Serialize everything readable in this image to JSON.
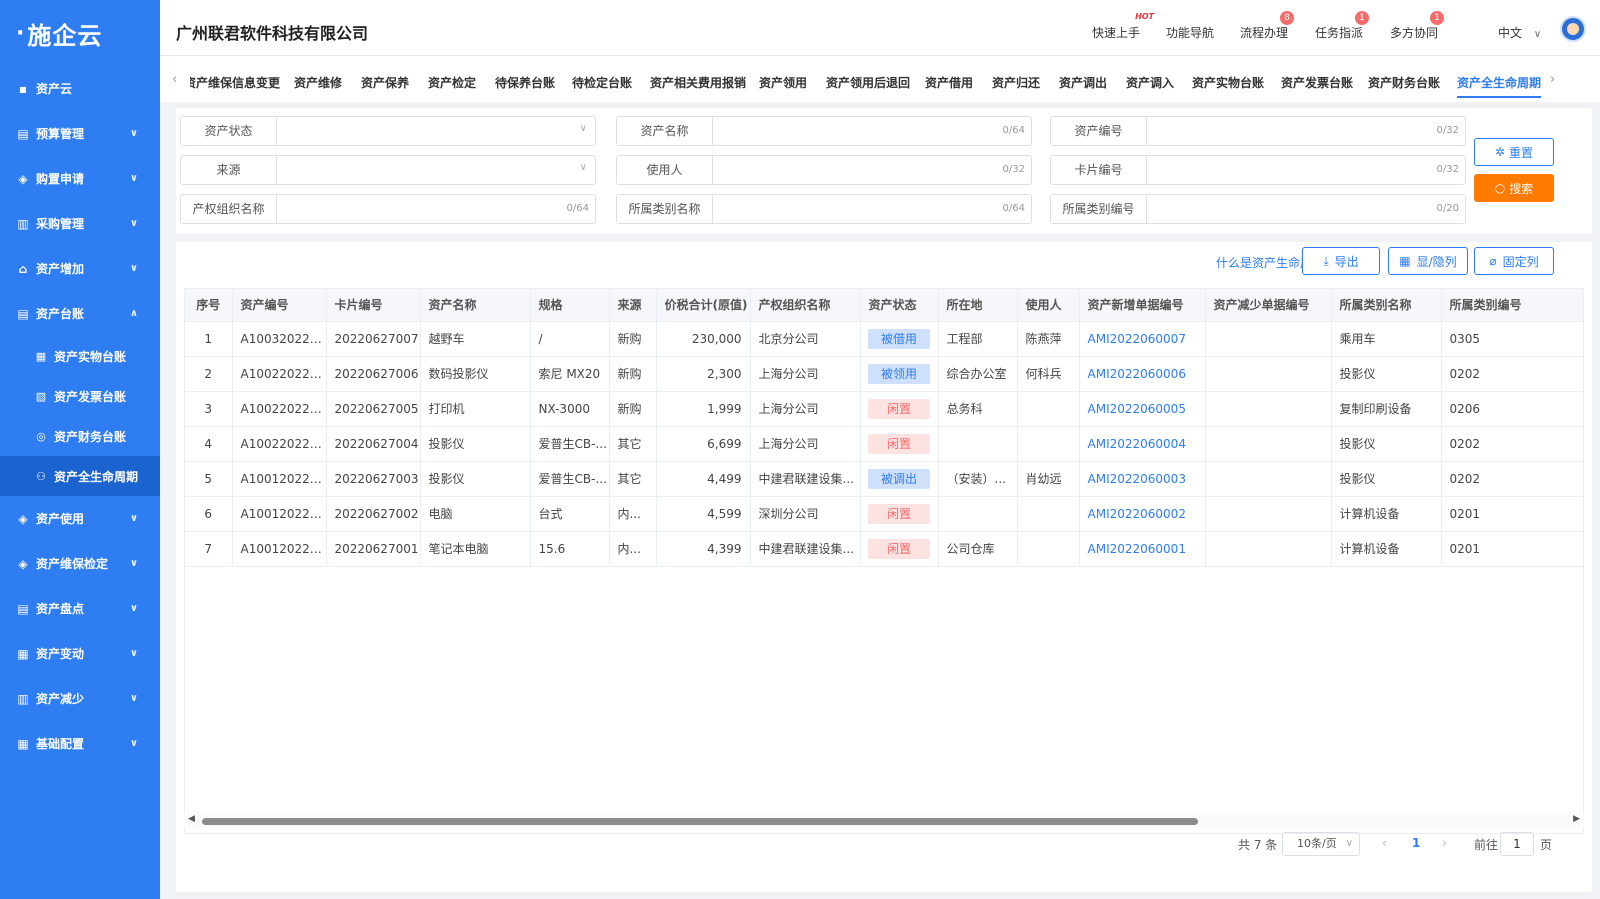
{
  "sidebar": {
    "logo": "施企云",
    "items": [
      {
        "label": "资产云",
        "icon": "grid-icon",
        "chev": ""
      },
      {
        "label": "预算管理",
        "icon": "budget-icon",
        "chev": "∨"
      },
      {
        "label": "购置申请",
        "icon": "cube-icon",
        "chev": "∨"
      },
      {
        "label": "采购管理",
        "icon": "clipboard-icon",
        "chev": "∨"
      },
      {
        "label": "资产增加",
        "icon": "house-icon",
        "chev": "∨"
      },
      {
        "label": "资产台账",
        "icon": "ledger-icon",
        "chev": "∧"
      }
    ],
    "subitems": [
      {
        "label": "资产实物台账",
        "icon": "apps-icon"
      },
      {
        "label": "资产发票台账",
        "icon": "invoice-icon"
      },
      {
        "label": "资产财务台账",
        "icon": "coin-icon"
      },
      {
        "label": "资产全生命周期",
        "icon": "tree-icon"
      }
    ],
    "items2": [
      {
        "label": "资产使用",
        "icon": "layers-icon"
      },
      {
        "label": "资产维保检定",
        "icon": "cube-icon"
      },
      {
        "label": "资产盘点",
        "icon": "stack-icon"
      },
      {
        "label": "资产变动",
        "icon": "apps-icon"
      },
      {
        "label": "资产减少",
        "icon": "clipboard-icon"
      },
      {
        "label": "基础配置",
        "icon": "apps-icon"
      }
    ],
    "chev_down": "∨"
  },
  "header": {
    "company": "广州联君软件科技有限公司",
    "nav": [
      {
        "label": "快速上手",
        "extra": "HOT"
      },
      {
        "label": "功能导航",
        "extra": ""
      },
      {
        "label": "流程办理",
        "extra": "8"
      },
      {
        "label": "任务指派",
        "extra": "1"
      },
      {
        "label": "多方协同",
        "extra": "1"
      }
    ],
    "lang": "中文"
  },
  "tabs": [
    "资产维保信息变更",
    "资产维修",
    "资产保养",
    "资产检定",
    "待保养台账",
    "待检定台账",
    "资产相关费用报销",
    "资产领用",
    "资产领用后退回",
    "资产借用",
    "资产归还",
    "资产调出",
    "资产调入",
    "资产实物台账",
    "资产发票台账",
    "资产财务台账",
    "资产全生命周期"
  ],
  "filters": {
    "status": "资产状态",
    "name": "资产名称",
    "name_cnt": "0/64",
    "code": "资产编号",
    "code_cnt": "0/32",
    "source": "来源",
    "user": "使用人",
    "user_cnt": "0/32",
    "card": "卡片编号",
    "card_cnt": "0/32",
    "org": "产权组织名称",
    "org_cnt": "0/64",
    "catname": "所属类别名称",
    "catname_cnt": "0/64",
    "catcode": "所属类别编号",
    "catcode_cnt": "0/20",
    "reset": "重置",
    "search": "搜索"
  },
  "toolbar": {
    "help": "什么是资产生命周期?",
    "export": "导出",
    "toggle_cols": "显/隐列",
    "fix_cols": "固定列"
  },
  "table": {
    "headers": [
      "序号",
      "资产编号",
      "卡片编号",
      "资产名称",
      "规格",
      "来源",
      "价税合计(原值)",
      "产权组织名称",
      "资产状态",
      "所在地",
      "使用人",
      "资产新增单据编号",
      "资产减少单据编号",
      "所属类别名称",
      "所属类别编号"
    ],
    "rows": [
      [
        "1",
        "A100320220...",
        "20220627007",
        "越野车",
        "/",
        "新购",
        "230,000",
        "北京分公司",
        "被借用",
        "工程部",
        "陈燕萍",
        "AMI2022060007",
        "",
        "乘用车",
        "0305"
      ],
      [
        "2",
        "A100220220...",
        "20220627006",
        "数码投影仪",
        "索尼 MX20",
        "新购",
        "2,300",
        "上海分公司",
        "被领用",
        "综合办公室",
        "何科兵",
        "AMI2022060006",
        "",
        "投影仪",
        "0202"
      ],
      [
        "3",
        "A100220220...",
        "20220627005",
        "打印机",
        "NX-3000",
        "新购",
        "1,999",
        "上海分公司",
        "闲置",
        "总务科",
        "",
        "AMI2022060005",
        "",
        "复制印刷设备",
        "0206"
      ],
      [
        "4",
        "A100220220...",
        "20220627004",
        "投影仪",
        "爱普生CB-...",
        "其它",
        "6,699",
        "上海分公司",
        "闲置",
        "",
        "",
        "AMI2022060004",
        "",
        "投影仪",
        "0202"
      ],
      [
        "5",
        "A100120220...",
        "20220627003",
        "投影仪",
        "爱普生CB-...",
        "其它",
        "4,499",
        "中建君联建设集...",
        "被调出",
        "（安装）...",
        "肖幼远",
        "AMI2022060003",
        "",
        "投影仪",
        "0202"
      ],
      [
        "6",
        "A100120220...",
        "20220627002",
        "电脑",
        "台式",
        "内...",
        "4,599",
        "深圳分公司",
        "闲置",
        "",
        "",
        "AMI2022060002",
        "",
        "计算机设备",
        "0201"
      ],
      [
        "7",
        "A100120220...",
        "20220627001",
        "笔记本电脑",
        "15.6",
        "内...",
        "4,399",
        "中建君联建设集...",
        "闲置",
        "公司仓库",
        "",
        "AMI2022060001",
        "",
        "计算机设备",
        "0201"
      ]
    ],
    "status_colors": {
      "被借用": "blue",
      "被领用": "blue",
      "被调出": "blue",
      "闲置": "red"
    }
  },
  "pagination": {
    "total": "共 7 条",
    "page_size": "10条/页",
    "current": "1",
    "goto": "前往",
    "page_input": "1",
    "page_unit": "页"
  },
  "colors": {
    "primary": "#2f7df2",
    "sidebar": "#2f7df2",
    "orange": "#ff7a00"
  }
}
